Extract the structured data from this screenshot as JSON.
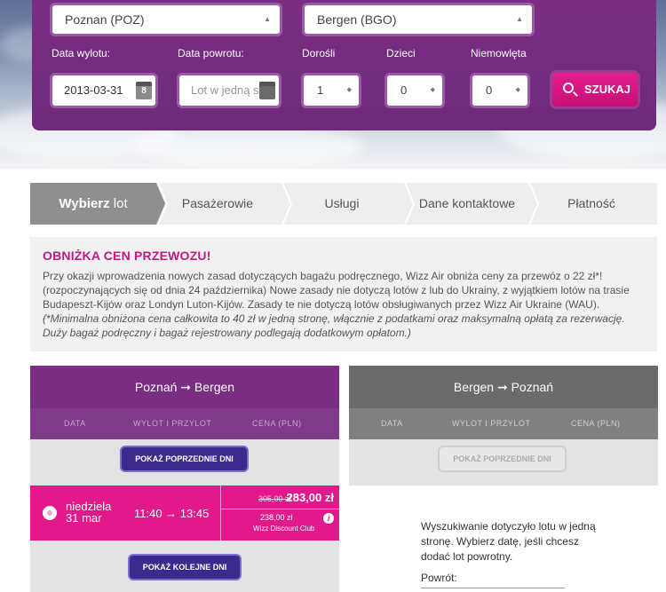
{
  "search": {
    "from": "Poznan (POZ)",
    "to": "Bergen (BGO)",
    "labels": {
      "departure": "Data wylotu:",
      "return": "Data powrotu:",
      "adults": "Dorośli",
      "children": "Dzieci",
      "infants": "Niemowlęta"
    },
    "departure_date": "2013-03-31",
    "return_placeholder": "Lot w jedną st",
    "calendar_day": "8",
    "adults": "1",
    "children": "0",
    "infants": "0",
    "button": "SZUKAJ"
  },
  "steps": {
    "step1_bold": "Wybierz",
    "step1_rest": "lot",
    "step2": "Pasażerowie",
    "step3": "Usługi",
    "step4": "Dane kontaktowe",
    "step5": "Płatność"
  },
  "notice": {
    "title": "OBNIŻKA CEN PRZEWOZU!",
    "body": "Przy okazji wprowadzenia nowych zasad dotyczących bagażu podręcznego, Wizz Air obniża ceny za przewóz o 22 zł*! (rozpoczynających się od dnia 24 października) Nowe zasady nie dotyczą lotów z lub do Ukrainy, z wyjątkiem lotów na trasie Budapeszt-Kijów oraz Londyn Luton-Kijów. Zasady te nie dotyczą lotów obsługiwanych przez Wizz Air Ukraine (WAU).",
    "footnote": "(*Minimalna obniżona cena całkowita to 40 zł w jedną stronę, włącznie z podatkami oraz maksymalną opłatą za rezerwację. Duży bagaż podręczny i bagaż rejestrowany podlegają dodatkowym opłatom.)"
  },
  "outbound": {
    "route": "Poznań ➞ Bergen",
    "col_date": "DATA",
    "col_flight": "WYLOT I PRZYLOT",
    "col_price": "CENA (PLN)",
    "prev_button": "POKAŻ POPRZEDNIE DNI",
    "next_button": "POKAŻ KOLEJNE DNI",
    "flight": {
      "day": "niedziela",
      "date": "31 mar",
      "times": "11:40 → 13:45",
      "old_price": "305,00 zł",
      "price": "283,00 zł",
      "club_price": "238,00 zł",
      "club_label": "Wizz Discount Club",
      "info": "i"
    }
  },
  "inbound": {
    "route": "Bergen ➞ Poznań",
    "col_date": "DATA",
    "col_flight": "WYLOT I PRZYLOT",
    "col_price": "CENA (PLN)",
    "prev_button": "POKAŻ POPRZEDNIE DNI",
    "info_text": "Wyszukiwanie dotyczyło lotu w jedną stronę. Wybierz datę, jeśli chcesz dodać lot powrotny.",
    "return_label": "Powrót:"
  },
  "colors": {
    "purple": "#7a2e83",
    "pink": "#e1198a",
    "button_pink": "#c70f76",
    "dark_button": "#3b2a8c"
  }
}
